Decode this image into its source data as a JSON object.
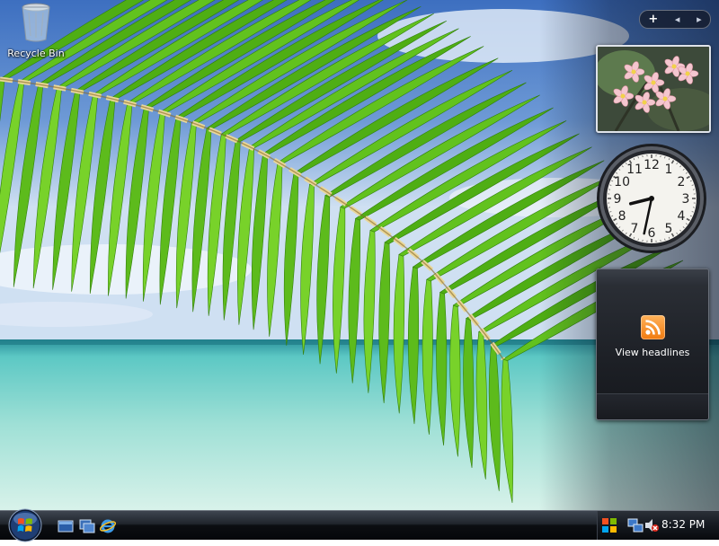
{
  "desktop": {
    "icons": [
      {
        "label": "Recycle Bin",
        "icon": "recycle-bin-icon"
      }
    ]
  },
  "sidebar": {
    "controls": {
      "add": "+",
      "previous": "◂",
      "next": "▸"
    },
    "clock": {
      "hour": 8,
      "minute": 32,
      "numerals": [
        "12",
        "1",
        "2",
        "3",
        "4",
        "5",
        "6",
        "7",
        "8",
        "9",
        "10",
        "11"
      ]
    },
    "feed": {
      "link_label": "View headlines",
      "icon": "rss-icon"
    }
  },
  "taskbar": {
    "start_icon": "windows-logo-icon",
    "quick_launch": [
      "show-desktop-icon",
      "switch-windows-icon",
      "internet-explorer-icon"
    ],
    "tray": {
      "icons": [
        "windows-sidebar-icon",
        "network-icon",
        "volume-muted-icon"
      ],
      "time": "8:32 PM"
    }
  },
  "colors": {
    "taskbar": "#0c0e12",
    "accent_rss": "#f07a10",
    "palm_green": "#5cbe1e"
  }
}
